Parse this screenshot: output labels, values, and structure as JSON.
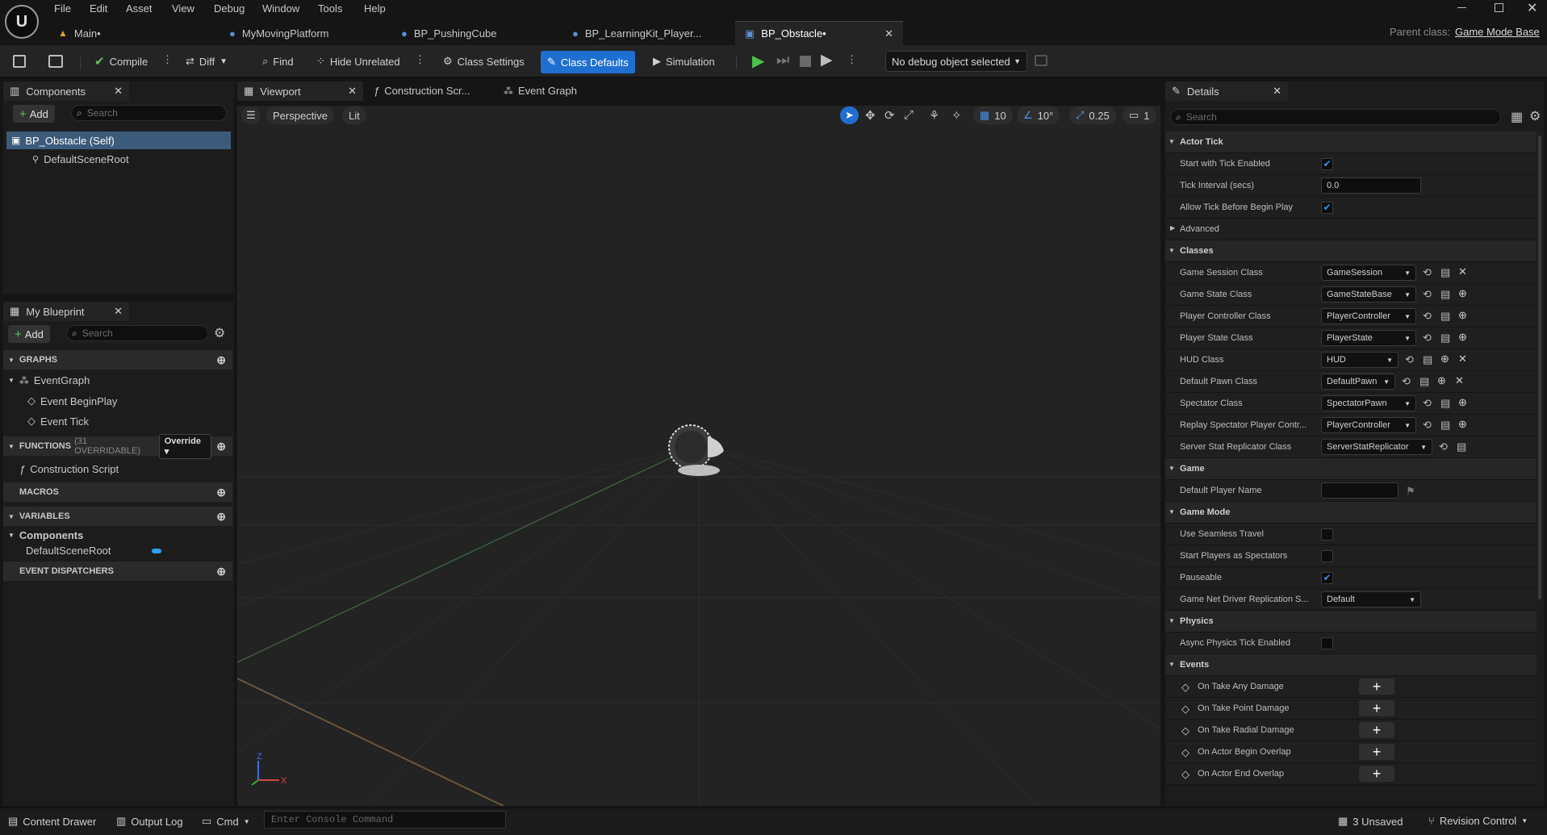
{
  "menu": {
    "items": [
      "File",
      "Edit",
      "Asset",
      "View",
      "Debug",
      "Window",
      "Tools",
      "Help"
    ]
  },
  "tabs": [
    {
      "label": "Main•",
      "icon": "level-icon"
    },
    {
      "label": "MyMovingPlatform",
      "icon": "blueprint-icon"
    },
    {
      "label": "BP_PushingCube",
      "icon": "blueprint-icon"
    },
    {
      "label": "BP_LearningKit_Player...",
      "icon": "blueprint-icon"
    },
    {
      "label": "BP_Obstacle•",
      "icon": "blueprint-icon"
    }
  ],
  "parent_class": {
    "label": "Parent class:",
    "value": "Game Mode Base"
  },
  "toolbar": {
    "compile": "Compile",
    "diff": "Diff",
    "find": "Find",
    "hide_unrelated": "Hide Unrelated",
    "class_settings": "Class Settings",
    "class_defaults": "Class Defaults",
    "simulation": "Simulation",
    "debug_select": "No debug object selected"
  },
  "components_panel": {
    "title": "Components",
    "add": "Add",
    "search_placeholder": "Search",
    "items": [
      "BP_Obstacle (Self)",
      "DefaultSceneRoot"
    ]
  },
  "my_blueprint": {
    "title": "My Blueprint",
    "add": "Add",
    "search_placeholder": "Search",
    "graphs_header": "GRAPHS",
    "event_graph": "EventGraph",
    "events": [
      "Event BeginPlay",
      "Event Tick"
    ],
    "functions_header": "FUNCTIONS",
    "functions_count": "(31 OVERRIDABLE)",
    "override": "Override",
    "construction_script": "Construction Script",
    "macros_header": "MACROS",
    "variables_header": "VARIABLES",
    "components_group": "Components",
    "default_scene_root": "DefaultSceneRoot",
    "dispatchers_header": "EVENT DISPATCHERS"
  },
  "editor_tabs": {
    "viewport": "Viewport",
    "construction": "Construction Scr...",
    "event_graph": "Event Graph"
  },
  "viewport": {
    "perspective": "Perspective",
    "lit": "Lit",
    "grid_snap": "10",
    "rot_snap": "10°",
    "scale_snap": "0.25",
    "camera_speed": "1",
    "axis_x": "X",
    "axis_z": "Z"
  },
  "details": {
    "title": "Details",
    "search_placeholder": "Search",
    "actor_tick": {
      "header": "Actor Tick",
      "start_enabled": "Start with Tick Enabled",
      "tick_interval": "Tick Interval (secs)",
      "tick_interval_value": "0.0",
      "allow_before_begin": "Allow Tick Before Begin Play",
      "advanced": "Advanced"
    },
    "classes": {
      "header": "Classes",
      "rows": [
        {
          "label": "Game Session Class",
          "value": "GameSession"
        },
        {
          "label": "Game State Class",
          "value": "GameStateBase"
        },
        {
          "label": "Player Controller Class",
          "value": "PlayerController"
        },
        {
          "label": "Player State Class",
          "value": "PlayerState"
        },
        {
          "label": "HUD Class",
          "value": "HUD"
        },
        {
          "label": "Default Pawn Class",
          "value": "DefaultPawn"
        },
        {
          "label": "Spectator Class",
          "value": "SpectatorPawn"
        },
        {
          "label": "Replay Spectator Player Contr...",
          "value": "PlayerController"
        },
        {
          "label": "Server Stat Replicator Class",
          "value": "ServerStatReplicator"
        }
      ]
    },
    "game": {
      "header": "Game",
      "default_player_name": "Default Player Name"
    },
    "game_mode": {
      "header": "Game Mode",
      "seamless": "Use Seamless Travel",
      "spectators": "Start Players as Spectators",
      "pauseable": "Pauseable",
      "net_driver": "Game Net Driver Replication S...",
      "net_driver_value": "Default"
    },
    "physics": {
      "header": "Physics",
      "async_tick": "Async Physics Tick Enabled"
    },
    "events": {
      "header": "Events",
      "rows": [
        "On Take Any Damage",
        "On Take Point Damage",
        "On Take Radial Damage",
        "On Actor Begin Overlap",
        "On Actor End Overlap"
      ]
    }
  },
  "statusbar": {
    "content_drawer": "Content Drawer",
    "output_log": "Output Log",
    "cmd": "Cmd",
    "console_placeholder": "Enter Console Command",
    "unsaved": "3 Unsaved",
    "revision_control": "Revision Control"
  },
  "colors": {
    "accent": "#1f6fd1",
    "check": "#3d8ee8",
    "play": "#3db13d",
    "selected_row": "#3c5a7a"
  }
}
